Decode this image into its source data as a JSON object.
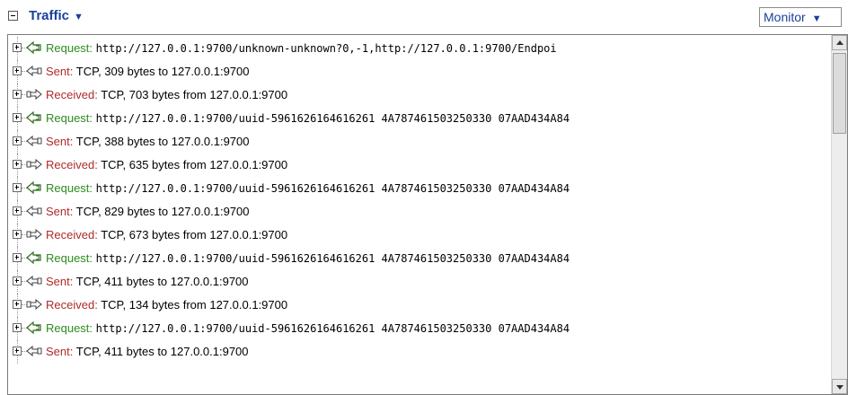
{
  "header": {
    "title": "Traffic",
    "caret": "▼",
    "monitor_label": "Monitor",
    "monitor_caret": "▼"
  },
  "entries": [
    {
      "type": "request",
      "label": "Request:",
      "detail": "http://127.0.0.1:9700/unknown-unknown?0,-1,http://127.0.0.1:9700/Endpoi"
    },
    {
      "type": "sent",
      "label": "Sent:",
      "detail": "TCP, 309 bytes to 127.0.0.1:9700"
    },
    {
      "type": "received",
      "label": "Received:",
      "detail": "TCP, 703 bytes from 127.0.0.1:9700"
    },
    {
      "type": "request",
      "label": "Request:",
      "detail": "http://127.0.0.1:9700/uuid-5961626164616261 4A787461503250330 07AAD434A84"
    },
    {
      "type": "sent",
      "label": "Sent:",
      "detail": "TCP, 388 bytes to 127.0.0.1:9700"
    },
    {
      "type": "received",
      "label": "Received:",
      "detail": "TCP, 635 bytes from 127.0.0.1:9700"
    },
    {
      "type": "request",
      "label": "Request:",
      "detail": "http://127.0.0.1:9700/uuid-5961626164616261 4A787461503250330 07AAD434A84"
    },
    {
      "type": "sent",
      "label": "Sent:",
      "detail": "TCP, 829 bytes to 127.0.0.1:9700"
    },
    {
      "type": "received",
      "label": "Received:",
      "detail": "TCP, 673 bytes from 127.0.0.1:9700"
    },
    {
      "type": "request",
      "label": "Request:",
      "detail": "http://127.0.0.1:9700/uuid-5961626164616261 4A787461503250330 07AAD434A84"
    },
    {
      "type": "sent",
      "label": "Sent:",
      "detail": "TCP, 411 bytes to 127.0.0.1:9700"
    },
    {
      "type": "received",
      "label": "Received:",
      "detail": "TCP, 134 bytes from 127.0.0.1:9700"
    },
    {
      "type": "request",
      "label": "Request:",
      "detail": "http://127.0.0.1:9700/uuid-5961626164616261 4A787461503250330 07AAD434A84"
    },
    {
      "type": "sent",
      "label": "Sent:",
      "detail": "TCP, 411 bytes to 127.0.0.1:9700"
    }
  ],
  "colors": {
    "title": "#1a3f9c",
    "request_label": "#2e8b1f",
    "transfer_label": "#b02a2a"
  },
  "icons": {
    "request": "request-arrow-icon",
    "sent": "sent-arrow-icon",
    "received": "received-arrow-icon"
  }
}
